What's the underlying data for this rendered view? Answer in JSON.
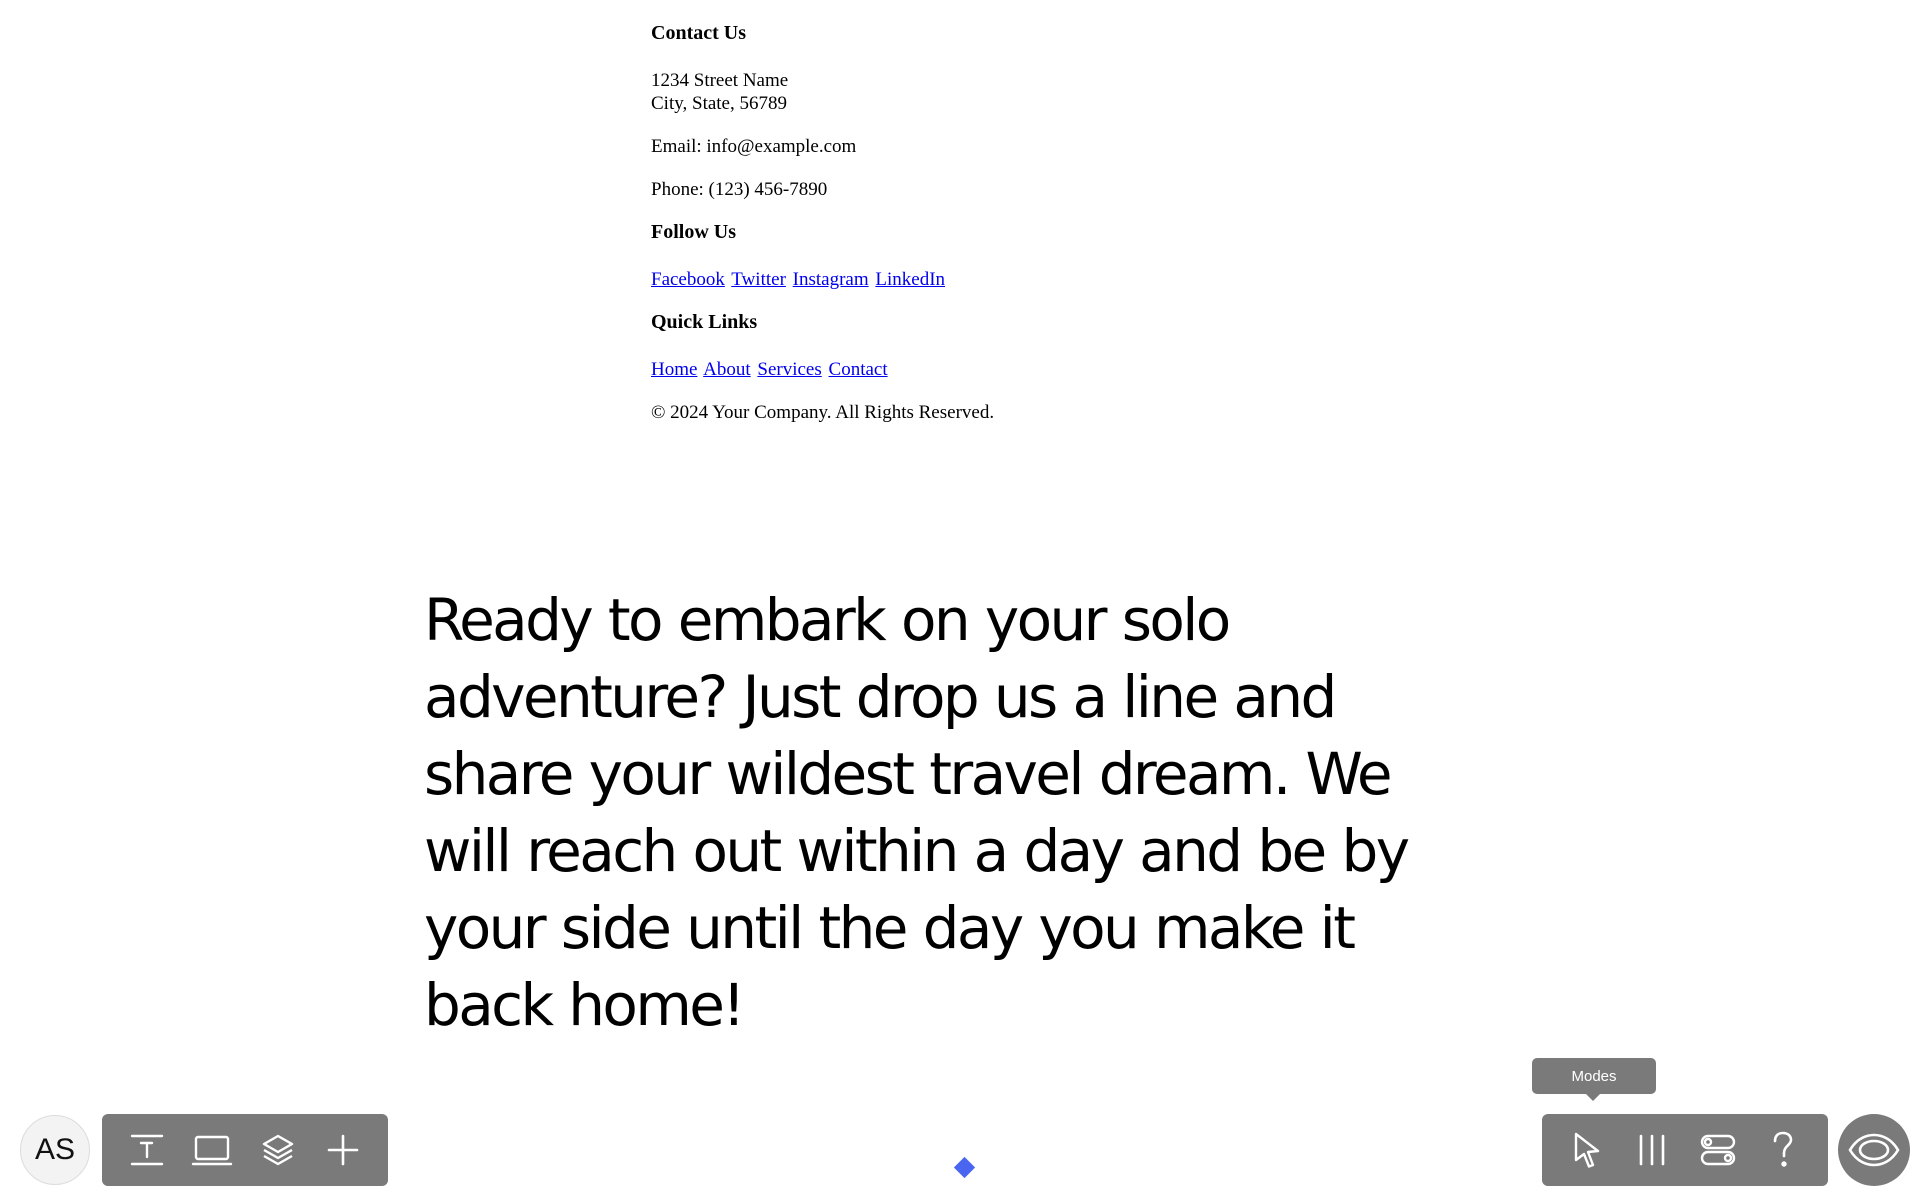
{
  "footer": {
    "contact_heading": "Contact Us",
    "address_line1": "1234 Street Name",
    "address_line2": "City, State, 56789",
    "email": "Email: info@example.com",
    "phone": "Phone: (123) 456-7890",
    "follow_heading": "Follow Us",
    "social_links": [
      "Facebook",
      "Twitter",
      "Instagram",
      "LinkedIn"
    ],
    "quick_heading": "Quick Links",
    "quick_links": [
      "Home",
      "About",
      "Services",
      "Contact"
    ],
    "copyright": "© 2024 Your Company. All Rights Reserved."
  },
  "hero": {
    "text": "Ready to embark on your solo adventure? Just drop us a line and share your wildest travel dream. We will reach out within a day and be by your side until the day you make it back home!"
  },
  "toolbar": {
    "avatar_initials": "AS",
    "left_tools": [
      "text-tool-icon",
      "frame-icon",
      "layers-icon",
      "plus-icon"
    ],
    "right_tools": [
      "pointer-icon",
      "columns-icon",
      "toggles-icon",
      "help-icon"
    ],
    "tooltip": "Modes",
    "preview_icon": "eye-icon"
  },
  "colors": {
    "toolbar_bg": "#7a7a7a",
    "link": "#0000ee",
    "diamond": "#4a66f0"
  }
}
